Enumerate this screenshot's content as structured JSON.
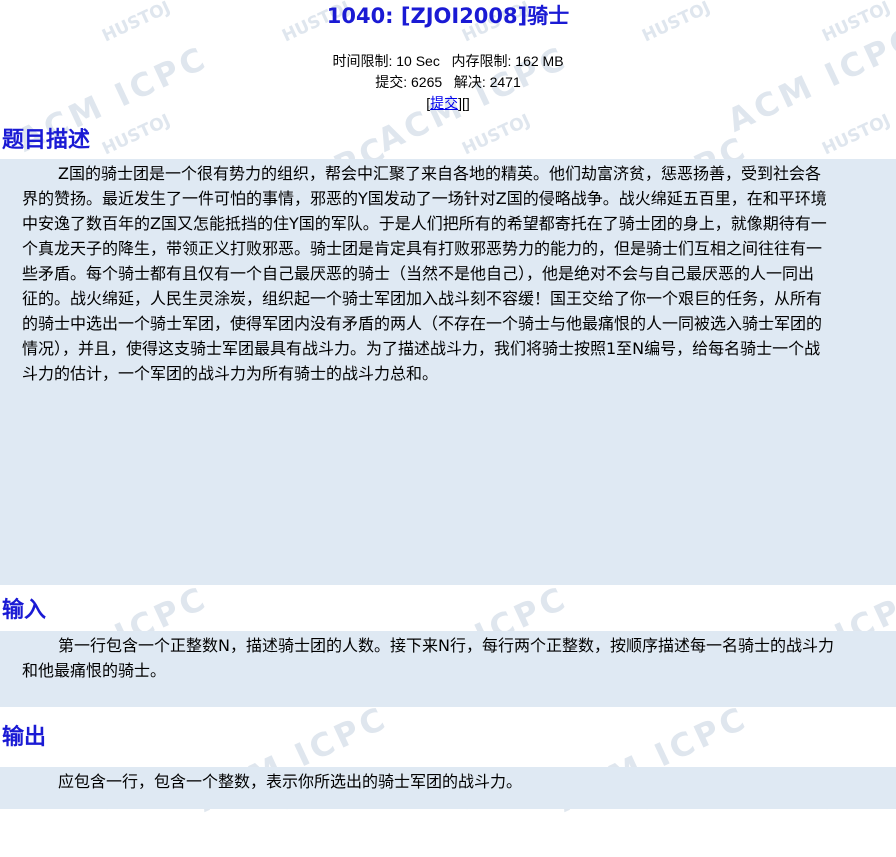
{
  "problem": {
    "title": "1040: [ZJOI2008]骑士",
    "time_limit": "时间限制: 10 Sec",
    "memory_limit": "内存限制: 162 MB",
    "submits": "提交: 6265",
    "solved": "解决: 2471",
    "link_open": "[",
    "submit_link": "提交",
    "link_close": "][]"
  },
  "sections": {
    "description_title": "题目描述",
    "description_lines": [
      "Z国的骑士团是一个很有势力的组织，帮会中汇聚了来自各地的精英。他们劫富济贫，惩恶扬善，受到社会各",
      "界的赞扬。最近发生了一件可怕的事情，邪恶的Y国发动了一场针对Z国的侵略战争。战火绵延五百里，在和平环境",
      "中安逸了数百年的Z国又怎能抵挡的住Y国的军队。于是人们把所有的希望都寄托在了骑士团的身上，就像期待有一",
      "个真龙天子的降生，带领正义打败邪恶。骑士团是肯定具有打败邪恶势力的能力的，但是骑士们互相之间往往有一",
      "些矛盾。每个骑士都有且仅有一个自己最厌恶的骑士（当然不是他自己），他是绝对不会与自己最厌恶的人一同出",
      "征的。战火绵延，人民生灵涂炭，组织起一个骑士军团加入战斗刻不容缓！国王交给了你一个艰巨的任务，从所有",
      "的骑士中选出一个骑士军团，使得军团内没有矛盾的两人（不存在一个骑士与他最痛恨的人一同被选入骑士军团的",
      "情况），并且，使得这支骑士军团最具有战斗力。为了描述战斗力，我们将骑士按照1至N编号，给每名骑士一个战",
      "斗力的估计，一个军团的战斗力为所有骑士的战斗力总和。"
    ],
    "input_title": "输入",
    "input_lines": [
      "第一行包含一个正整数N，描述骑士团的人数。接下来N行，每行两个正整数，按顺序描述每一名骑士的战斗力",
      "和他最痛恨的骑士。"
    ],
    "output_title": "输出",
    "output_lines": [
      "应包含一行，包含一个整数，表示你所选出的骑士军团的战斗力。"
    ]
  },
  "watermark": {
    "small": "HUSTOJ",
    "big": "ACM ICPC"
  },
  "colors": {
    "title": "#1a1ad4",
    "box_bg": "#dfe9f3",
    "link": "#0000ee",
    "watermark": "#dfe6ee"
  }
}
